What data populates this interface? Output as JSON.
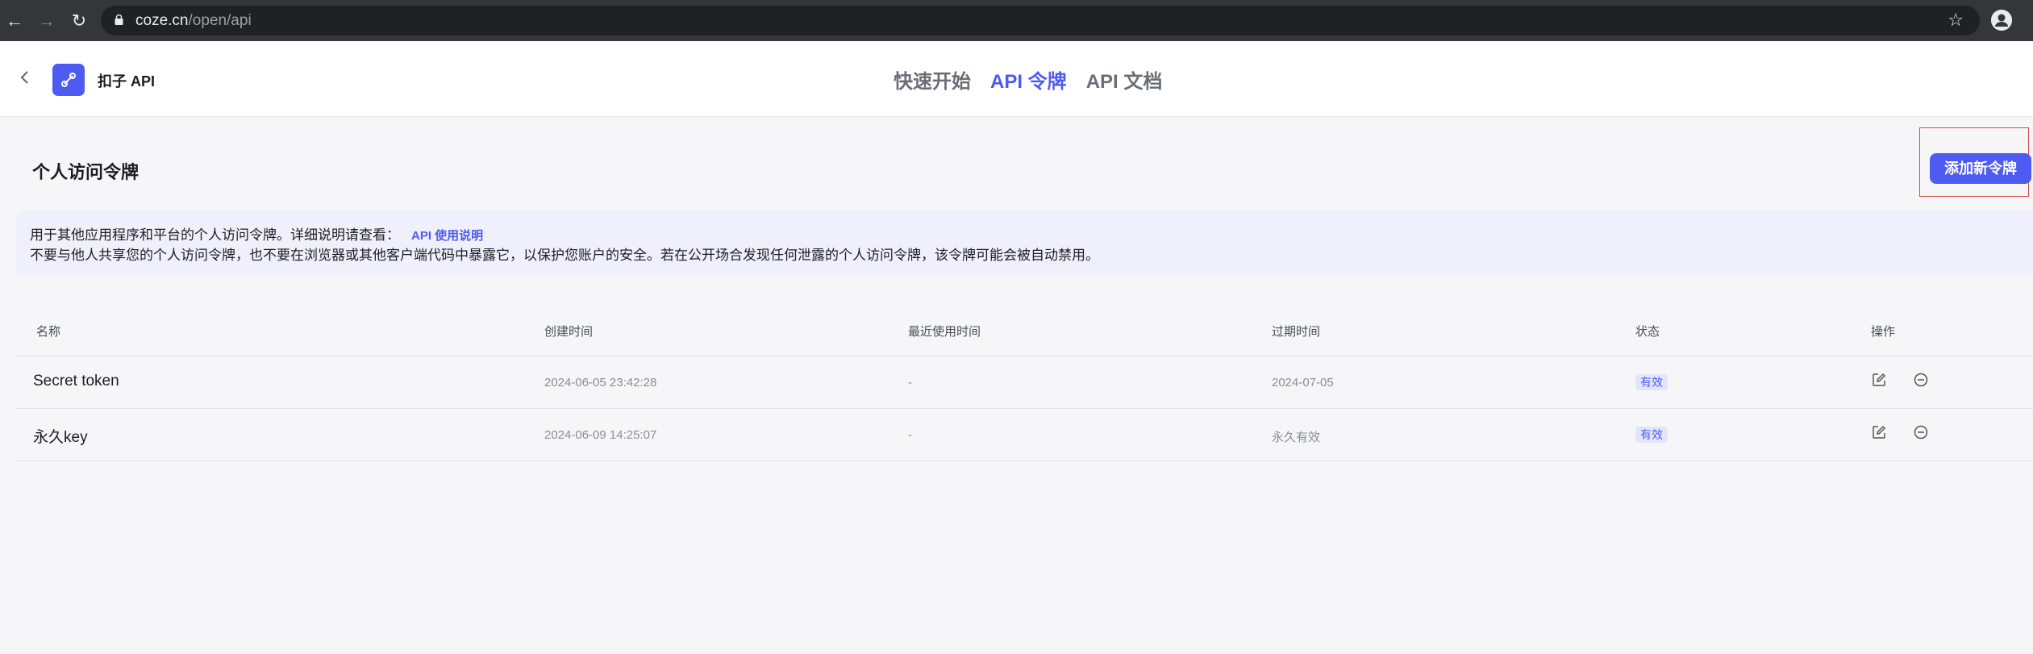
{
  "browser": {
    "url_host": "coze.cn",
    "url_path": "/open/api"
  },
  "header": {
    "app_title": "扣子 API",
    "tabs": [
      {
        "label": "快速开始",
        "active": false
      },
      {
        "label": "API 令牌",
        "active": true
      },
      {
        "label": "API 文档",
        "active": false
      }
    ]
  },
  "main": {
    "section_title": "个人访问令牌",
    "add_button_label": "添加新令牌",
    "notice": {
      "line1": "用于其他应用程序和平台的个人访问令牌。详细说明请查看：",
      "link": "API 使用说明",
      "line2": "不要与他人共享您的个人访问令牌，也不要在浏览器或其他客户端代码中暴露它，以保护您账户的安全。若在公开场合发现任何泄露的个人访问令牌，该令牌可能会被自动禁用。"
    },
    "table": {
      "columns": [
        "名称",
        "创建时间",
        "最近使用时间",
        "过期时间",
        "状态",
        "操作"
      ],
      "rows": [
        {
          "name": "Secret token",
          "created": "2024-06-05 23:42:28",
          "last_used": "-",
          "expires": "2024-07-05",
          "status": "有效"
        },
        {
          "name": "永久key",
          "created": "2024-06-09 14:25:07",
          "last_used": "-",
          "expires": "永久有效",
          "status": "有效"
        }
      ]
    }
  },
  "colors": {
    "accent": "#4e5bf0",
    "page_bg": "#f6f6f8",
    "notice_bg": "#f0f0fc",
    "highlight_border": "#d94a4a"
  }
}
